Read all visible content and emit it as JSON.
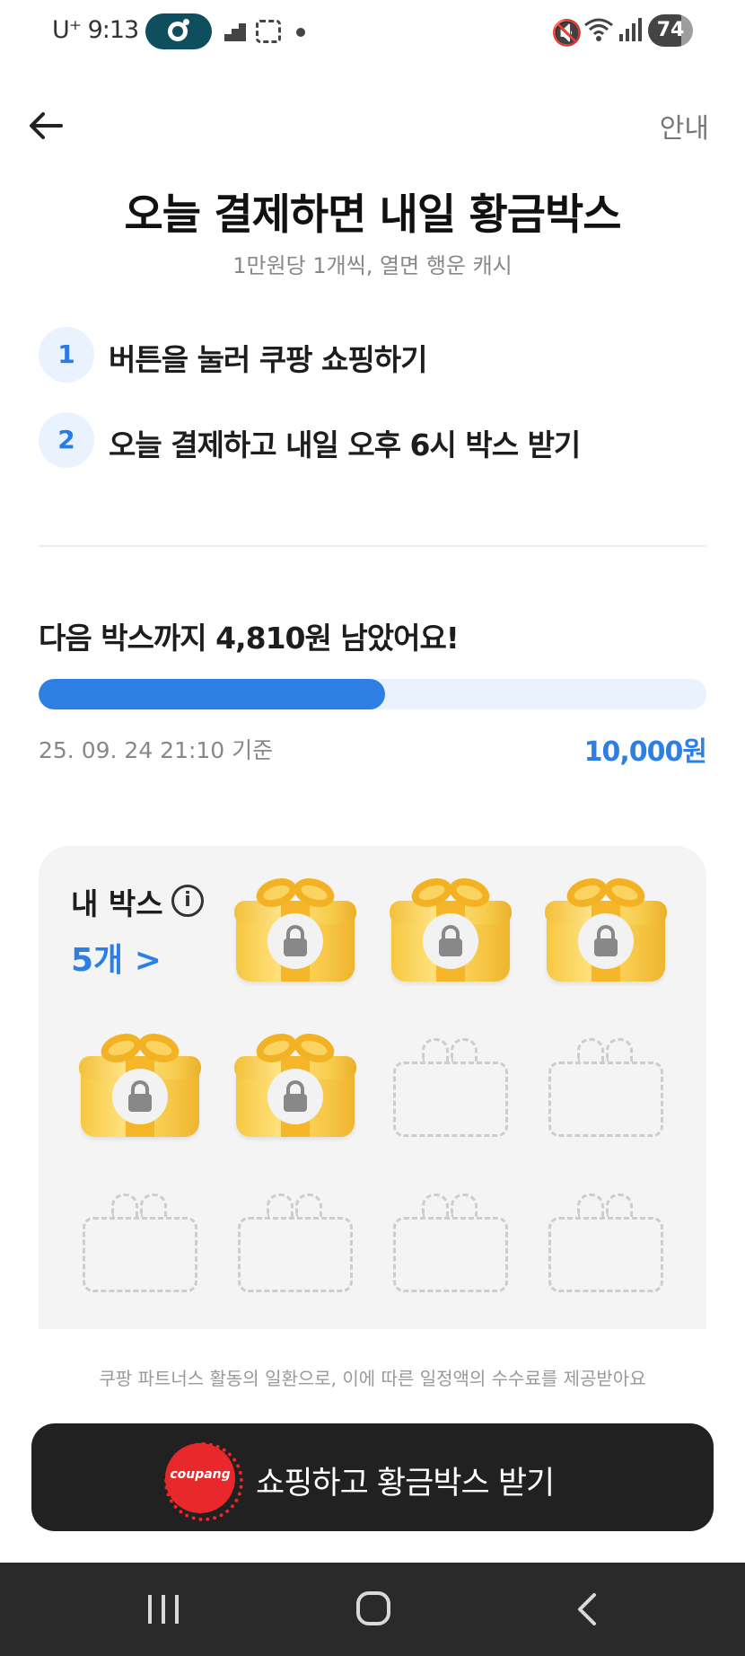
{
  "status_bar": {
    "carrier": "U⁺ 9:13",
    "battery_level": "74",
    "battery_fraction": 0.74,
    "icons": [
      "pill-app-icon",
      "mute-icon",
      "wifi-icon",
      "signal-icon",
      "battery-icon"
    ]
  },
  "header": {
    "back_icon": "arrow-left-icon",
    "guide_label": "안내"
  },
  "hero": {
    "title": "오늘 결제하면 내일 황금박스",
    "subtitle": "1만원당 1개씩, 열면 행운 캐시"
  },
  "steps": [
    {
      "number": "1",
      "text": "버튼을 눌러 쿠팡 쇼핑하기"
    },
    {
      "number": "2",
      "text": "오늘 결제하고 내일 오후 6시 박스 받기"
    }
  ],
  "progress": {
    "headline": "다음 박스까지 4,810원 남았어요!",
    "fraction": 0.519,
    "as_of": "25. 09. 24 21:10 기준",
    "goal": "10,000원",
    "accent_color": "#2e7fe3"
  },
  "my_boxes": {
    "title": "내 박스",
    "count_label": "5개 >",
    "filled_count": 5,
    "total_slots": 12
  },
  "disclaimer": "쿠팡 파트너스 활동의 일환으로, 이에 따른 일정액의 수수료를 제공받아요",
  "cta": {
    "badge_text": "coupang",
    "label": "쇼핑하고 황금박스 받기"
  },
  "nav": {
    "recents_icon": "recents-icon",
    "home_icon": "home-icon",
    "back_icon": "nav-back-icon"
  }
}
